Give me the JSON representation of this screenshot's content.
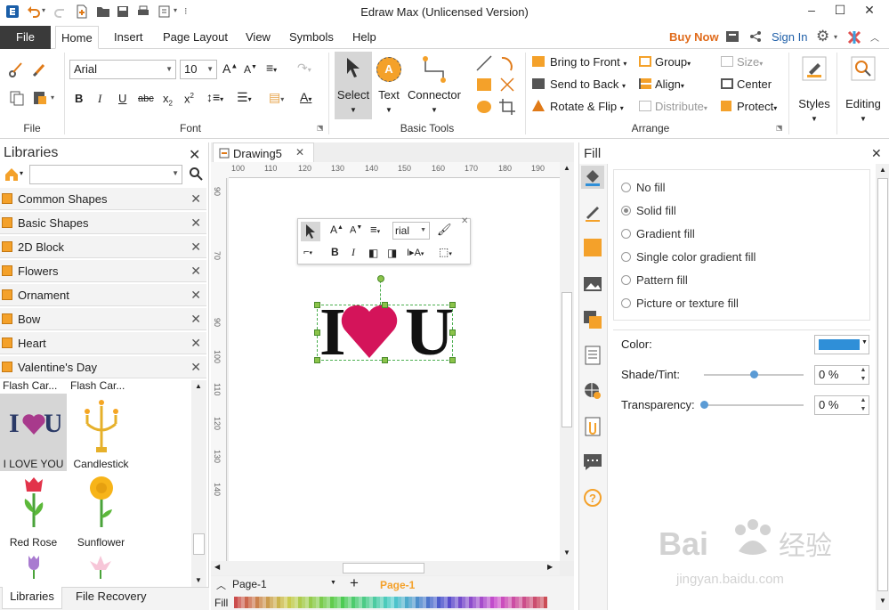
{
  "window": {
    "title": "Edraw Max (Unlicensed Version)"
  },
  "menu": {
    "file": "File",
    "tabs": [
      "Home",
      "Insert",
      "Page Layout",
      "View",
      "Symbols",
      "Help"
    ],
    "buy_now": "Buy Now",
    "sign_in": "Sign In"
  },
  "ribbon": {
    "groups": {
      "file": "File",
      "font": "Font",
      "basic_tools": "Basic Tools",
      "arrange": "Arrange"
    },
    "font_name": "Arial",
    "font_size": "10",
    "tools": {
      "select": "Select",
      "text": "Text",
      "connector": "Connector"
    },
    "arrange": {
      "bring_to_front": "Bring to Front",
      "send_to_back": "Send to Back",
      "rotate_flip": "Rotate & Flip",
      "group": "Group",
      "align": "Align",
      "distribute": "Distribute",
      "size": "Size",
      "center": "Center",
      "protect": "Protect"
    },
    "styles": "Styles",
    "editing": "Editing"
  },
  "libraries": {
    "title": "Libraries",
    "items": [
      "Common Shapes",
      "Basic Shapes",
      "2D Block",
      "Flowers",
      "Ornament",
      "Bow",
      "Heart",
      "Valentine's Day"
    ],
    "shape_headers": [
      "Flash Car...",
      "Flash Car..."
    ],
    "shapes": [
      "I LOVE YOU",
      "Candlestick",
      "Red Rose",
      "Sunflower"
    ],
    "bottom_tabs": [
      "Libraries",
      "File Recovery"
    ]
  },
  "canvas": {
    "tab": "Drawing5",
    "ruler_h": [
      "100",
      "110",
      "120",
      "130",
      "140",
      "150",
      "160",
      "170",
      "180",
      "190"
    ],
    "ruler_v": [
      "90",
      "70",
      "90",
      "100",
      "110",
      "120",
      "130",
      "140"
    ],
    "mini_font": "rial",
    "text_left": "I",
    "text_right": "U",
    "page_tab": "Page-1",
    "page_active": "Page-1",
    "fill_label": "Fill"
  },
  "fill": {
    "title": "Fill",
    "options": [
      "No fill",
      "Solid fill",
      "Gradient fill",
      "Single color gradient fill",
      "Pattern fill",
      "Picture or texture fill"
    ],
    "selected": "Solid fill",
    "color_label": "Color:",
    "color": "#2f8fd8",
    "shade_label": "Shade/Tint:",
    "shade_value": "0 %",
    "shade_level": 0.5,
    "transparency_label": "Transparency:",
    "transparency_value": "0 %",
    "transparency_level": 0
  },
  "colors": {
    "heart": "#d4145a",
    "orange": "#f4a12a",
    "brand_red": "#e06b1b",
    "link_blue": "#1f5fa8"
  }
}
